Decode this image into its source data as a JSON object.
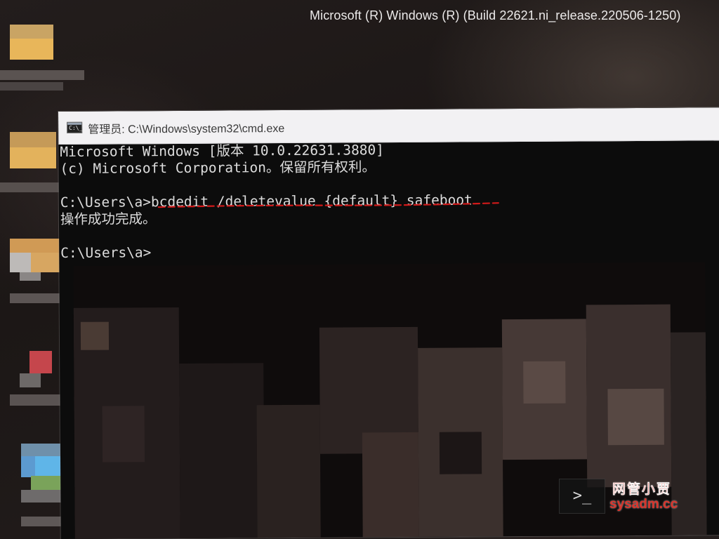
{
  "desktop": {
    "build_watermark": "Microsoft (R) Windows (R) (Build 22621.ni_release.220506-1250)"
  },
  "window": {
    "title": "管理员: C:\\Windows\\system32\\cmd.exe",
    "icon": "cmd-icon"
  },
  "console": {
    "lines": [
      "Microsoft Windows [版本 10.0.22631.3880]",
      "(c) Microsoft Corporation。保留所有权利。",
      "",
      "C:\\Users\\a>bcdedit /deletevalue {default} safeboot",
      "操作成功完成。",
      "",
      "C:\\Users\\a>"
    ],
    "highlighted_command": "bcdedit /deletevalue {default} safeboot",
    "highlight_color": "#d11a1a"
  },
  "watermark": {
    "icon": "terminal-icon",
    "prompt_glyph": ">_",
    "site_name": "网管小贾",
    "site_url": "sysadm.cc",
    "color": "#d9342b"
  }
}
